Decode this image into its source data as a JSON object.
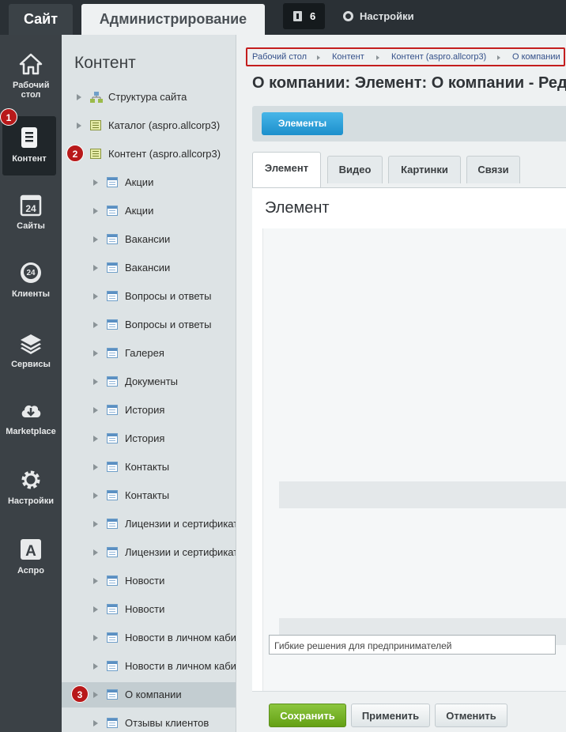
{
  "topbar": {
    "site_tab": "Сайт",
    "admin_tab": "Администрирование",
    "notifications_count": "6",
    "settings_label": "Настройки"
  },
  "leftnav": {
    "items": [
      {
        "label": "Рабочий стол",
        "icon": "home-icon"
      },
      {
        "label": "Контент",
        "icon": "document-icon"
      },
      {
        "label": "Сайты",
        "icon": "calendar-24-icon"
      },
      {
        "label": "Клиенты",
        "icon": "clients-24-icon"
      },
      {
        "label": "Сервисы",
        "icon": "layers-icon"
      },
      {
        "label": "Marketplace",
        "icon": "cloud-download-icon"
      },
      {
        "label": "Настройки",
        "icon": "gear-icon"
      },
      {
        "label": "Аспро",
        "icon": "aspro-a-icon"
      }
    ]
  },
  "badges": {
    "one": "1",
    "two": "2",
    "three": "3"
  },
  "tree": {
    "title": "Контент",
    "top_items": [
      {
        "label": "Структура сайта"
      },
      {
        "label": "Каталог (aspro.allcorp3)"
      },
      {
        "label": "Контент (aspro.allcorp3)"
      }
    ],
    "children": [
      {
        "label": "Акции"
      },
      {
        "label": "Акции"
      },
      {
        "label": "Вакансии"
      },
      {
        "label": "Вакансии"
      },
      {
        "label": "Вопросы и ответы"
      },
      {
        "label": "Вопросы и ответы"
      },
      {
        "label": "Галерея"
      },
      {
        "label": "Документы"
      },
      {
        "label": "История"
      },
      {
        "label": "История"
      },
      {
        "label": "Контакты"
      },
      {
        "label": "Контакты"
      },
      {
        "label": "Лицензии и сертификаты"
      },
      {
        "label": "Лицензии и сертификаты"
      },
      {
        "label": "Новости"
      },
      {
        "label": "Новости"
      },
      {
        "label": "Новости в личном кабинете"
      },
      {
        "label": "Новости в личном кабинете"
      },
      {
        "label": "О компании"
      },
      {
        "label": "Отзывы клиентов"
      }
    ]
  },
  "breadcrumbs": [
    "Рабочий стол",
    "Контент",
    "Контент (aspro.allcorp3)",
    "О компании"
  ],
  "page_title": "О компании: Элемент: О компании - Редактирование",
  "context_button": "Элементы",
  "tabs": [
    "Элемент",
    "Видео",
    "Картинки",
    "Связи"
  ],
  "panel_title": "Элемент",
  "input_value": "Гибкие решения для предпринимателей",
  "footer": {
    "save": "Сохранить",
    "apply": "Применить",
    "cancel": "Отменить"
  }
}
